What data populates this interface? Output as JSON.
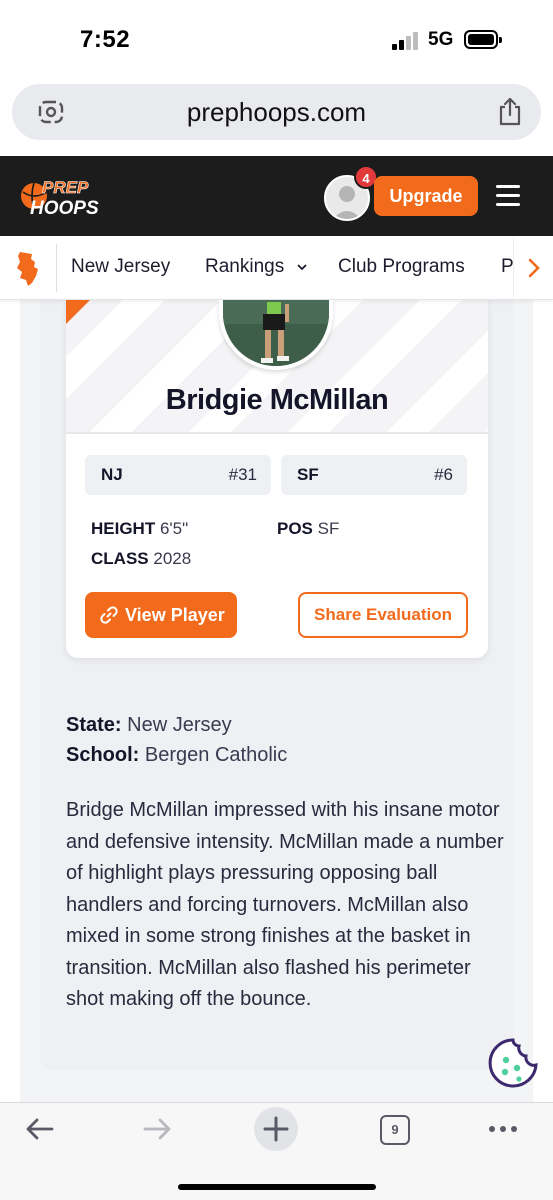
{
  "status_bar": {
    "time": "7:52",
    "network": "5G",
    "battery_percent": 100
  },
  "browser": {
    "url": "prephoops.com",
    "tab_count": "9"
  },
  "header": {
    "logo_line1": "PREP",
    "logo_line2": "HOOPS",
    "notification_count": "4",
    "upgrade_label": "Upgrade",
    "brand_color": "#f26a1b"
  },
  "sub_nav": {
    "items": [
      "New Jersey",
      "Rankings",
      "Club Programs",
      "P"
    ]
  },
  "player": {
    "name": "Bridgie McMillan",
    "state_rank": {
      "label": "NJ",
      "value": "#31"
    },
    "position_rank": {
      "label": "SF",
      "value": "#6"
    },
    "height_label": "HEIGHT",
    "height_value": "6'5\"",
    "pos_label": "POS",
    "pos_value": "SF",
    "class_label": "CLASS",
    "class_value": "2028",
    "view_player_label": "View Player",
    "share_label": "Share Evaluation"
  },
  "details": {
    "state_label": "State:",
    "state_value": "New Jersey",
    "school_label": "School:",
    "school_value": "Bergen Catholic",
    "evaluation": "Bridge McMillan impressed with his insane motor and defensive intensity. McMillan made a number of highlight plays pressuring opposing ball handlers and forcing turnovers. McMillan also mixed in some strong finishes at the basket in transition. McMillan also flashed his perimeter shot making off the bounce."
  },
  "icons": {
    "url_left": "lens-icon",
    "url_right": "share-icon",
    "back": "back-arrow-icon",
    "forward": "forward-arrow-icon",
    "new_tab": "plus-icon",
    "tabs": "tabs-icon",
    "more": "more-icon",
    "cookie": "cookie-icon"
  }
}
